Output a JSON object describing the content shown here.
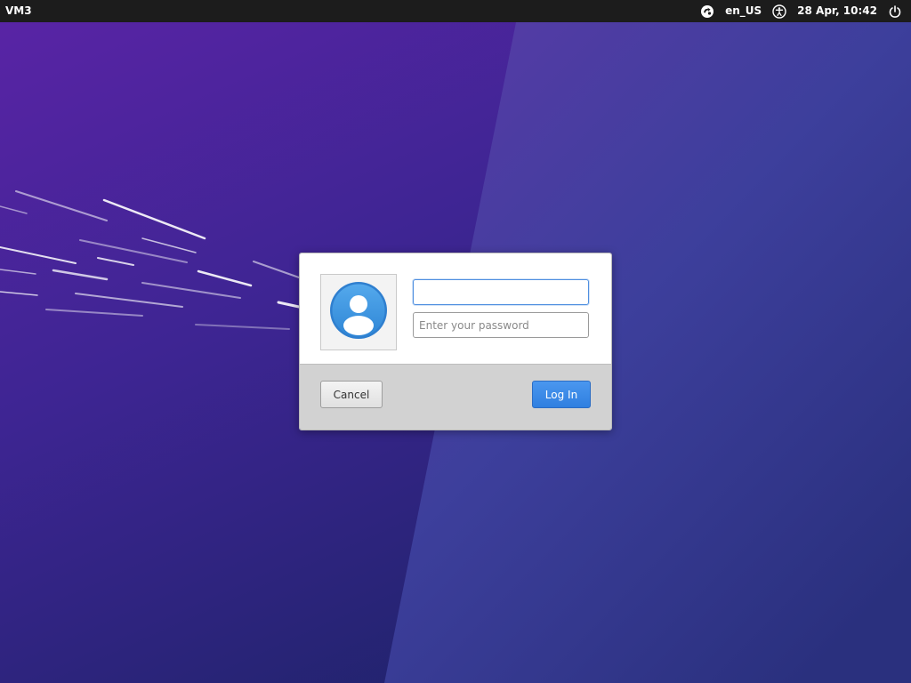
{
  "topbar": {
    "hostname": "VM3",
    "keyboard_layout": "en_US",
    "datetime": "28 Apr, 10:42",
    "icons": {
      "session": "session-icon",
      "accessibility": "accessibility-icon",
      "power": "power-icon"
    }
  },
  "login": {
    "username_value": "",
    "password_placeholder": "Enter your password",
    "cancel_label": "Cancel",
    "login_label": "Log In",
    "avatar_icon": "user-avatar-icon"
  },
  "colors": {
    "accent": "#3484e3",
    "wallpaper_primary": "#4a2a9e",
    "topbar": "#1c1c1c"
  }
}
